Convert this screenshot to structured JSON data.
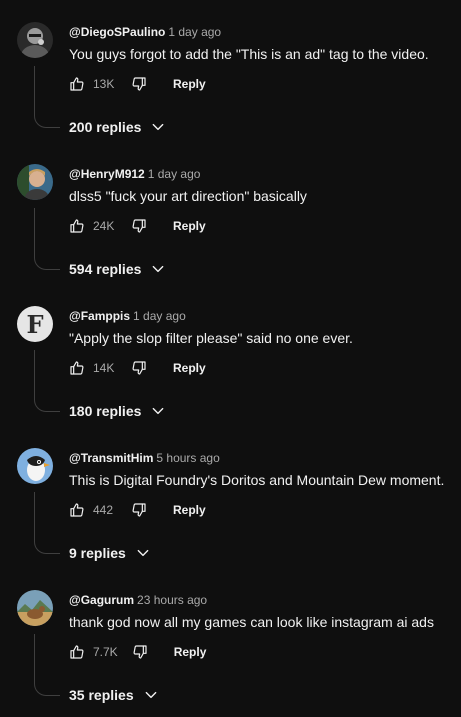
{
  "comments": [
    {
      "author": "@DiegoSPaulino",
      "timestamp": "1 day ago",
      "text": "You guys forgot to add the \"This is an ad\" tag to the video.",
      "likes": "13K",
      "reply_label": "Reply",
      "replies_label": "200 replies",
      "avatar_icon": "photo-avatar-icon",
      "avatar_color": "#6b6b6b"
    },
    {
      "author": "@HenryM912",
      "timestamp": "1 day ago",
      "text": "dlss5 \"fuck your art direction\" basically",
      "likes": "24K",
      "reply_label": "Reply",
      "replies_label": "594 replies",
      "avatar_icon": "photo-avatar-icon",
      "avatar_color": "#8a6a4a"
    },
    {
      "author": "@Famppis",
      "timestamp": "1 day ago",
      "text": "\"Apply the slop filter please\" said no one ever.",
      "likes": "14K",
      "reply_label": "Reply",
      "replies_label": "180 replies",
      "avatar_icon": "letter-f-avatar-icon",
      "avatar_letter": "F",
      "avatar_color": "#e6e6e6"
    },
    {
      "author": "@TransmitHim",
      "timestamp": "5 hours ago",
      "text": "This is Digital Foundry's Doritos and Mountain Dew moment.",
      "likes": "442",
      "reply_label": "Reply",
      "replies_label": "9 replies",
      "avatar_icon": "bird-avatar-icon",
      "avatar_color": "#7fb0e0"
    },
    {
      "author": "@Gagurum",
      "timestamp": "23 hours ago",
      "text": "thank god now all my games can look like instagram ai ads",
      "likes": "7.7K",
      "reply_label": "Reply",
      "replies_label": "35 replies",
      "avatar_icon": "landscape-avatar-icon",
      "avatar_color": "#7aa0b8"
    }
  ],
  "colors": {
    "background": "#0f0f0f",
    "primary_text": "#f1f1f1",
    "secondary_text": "#aaaaaa",
    "thread_line": "#3f3f3f"
  }
}
